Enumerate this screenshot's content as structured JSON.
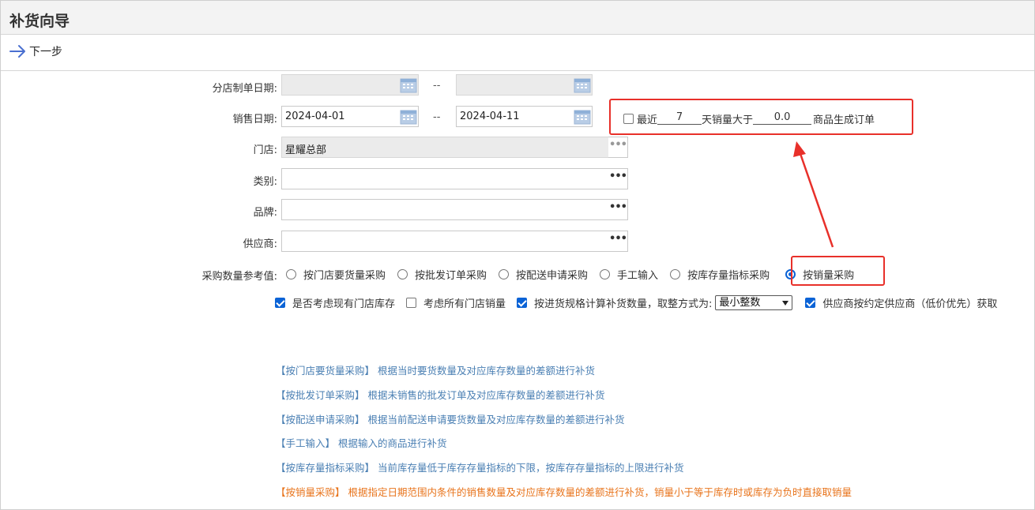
{
  "title": "补货向导",
  "toolbar": {
    "next_label": "下一步"
  },
  "form": {
    "branch_date_label": "分店制单日期:",
    "sales_date_label": "销售日期:",
    "sales_date_from": "2024-04-01",
    "sales_date_to": "2024-04-11",
    "date_separator": "--",
    "store_label": "门店:",
    "store_value": "星耀总部",
    "category_label": "类别:",
    "brand_label": "品牌:",
    "supplier_label": "供应商:",
    "more_glyph": "•••",
    "ref_label": "采购数量参考值:"
  },
  "recent": {
    "prefix": "最近",
    "days": "7",
    "middle": "天销量大于",
    "qty": "0.0",
    "suffix": "商品生成订单",
    "checked": false
  },
  "radios": [
    {
      "label": "按门店要货量采购",
      "checked": false
    },
    {
      "label": "按批发订单采购",
      "checked": false
    },
    {
      "label": "按配送申请采购",
      "checked": false
    },
    {
      "label": "手工输入",
      "checked": false
    },
    {
      "label": "按库存量指标采购",
      "checked": false
    },
    {
      "label": "按销量采购",
      "checked": true
    }
  ],
  "options": {
    "consider_stock": "是否考虑现有门店库存",
    "consider_all_sales": "考虑所有门店销量",
    "by_spec": "按进货规格计算补货数量，取整方式为:",
    "rounding": "最小整数",
    "supplier_contract": "供应商按约定供应商（低价优先）获取"
  },
  "descriptions": [
    "【按门店要货量采购】 根据当时要货数量及对应库存数量的差额进行补货",
    "【按批发订单采购】 根据未销售的批发订单及对应库存数量的差额进行补货",
    "【按配送申请采购】 根据当前配送申请要货数量及对应库存数量的差额进行补货",
    "【手工输入】 根据输入的商品进行补货",
    "【按库存量指标采购】 当前库存量低于库存存量指标的下限，按库存存量指标的上限进行补货",
    "【按销量采购】 根据指定日期范围内条件的销售数量及对应库存数量的差额进行补货，销量小于等于库存时或库存为负时直接取销量"
  ],
  "colors": {
    "accent": "#0b63d6",
    "annotation": "#e8302a",
    "link": "#4a7fb3",
    "highlight": "#e8741c"
  }
}
